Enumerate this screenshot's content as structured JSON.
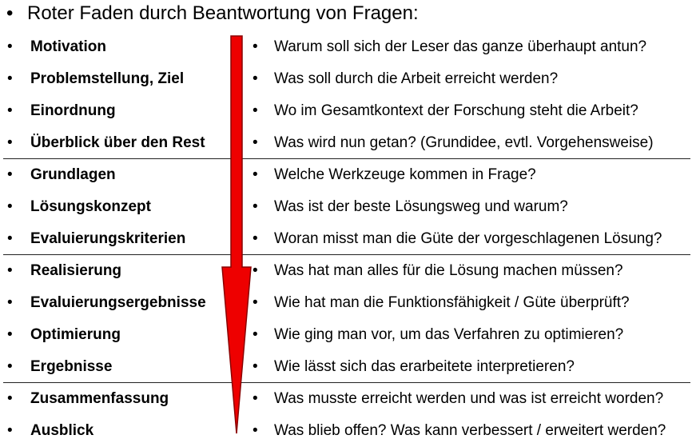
{
  "title": {
    "bullet": "•",
    "text": "Roter Faden durch Beantwortung von Fragen:"
  },
  "bullet": "•",
  "rows": [
    {
      "topic": "Motivation",
      "question": "Warum soll sich der Leser das ganze überhaupt antun?"
    },
    {
      "topic": "Problemstellung, Ziel",
      "question": "Was soll durch die Arbeit erreicht werden?"
    },
    {
      "topic": "Einordnung",
      "question": "Wo im Gesamtkontext der Forschung steht die Arbeit?"
    },
    {
      "topic": "Überblick über den Rest",
      "question": "Was wird nun getan? (Grundidee, evtl. Vorgehensweise)"
    },
    {
      "topic": "Grundlagen",
      "question": "Welche Werkzeuge kommen in Frage?"
    },
    {
      "topic": "Lösungskonzept",
      "question": "Was ist der beste Lösungsweg und warum?"
    },
    {
      "topic": "Evaluierungskriterien",
      "question": "Woran misst man die Güte der vorgeschlagenen Lösung?"
    },
    {
      "topic": "Realisierung",
      "question": "Was hat man alles für die Lösung machen müssen?"
    },
    {
      "topic": "Evaluierungsergebnisse",
      "question": "Wie hat man die Funktionsfähigkeit / Güte überprüft?"
    },
    {
      "topic": "Optimierung",
      "question": "Wie ging man vor, um das Verfahren zu optimieren?"
    },
    {
      "topic": "Ergebnisse",
      "question": "Wie lässt sich das erarbeitete interpretieren?"
    },
    {
      "topic": "Zusammenfassung",
      "question": "Was musste erreicht werden und was ist erreicht worden?"
    },
    {
      "topic": "Ausblick",
      "question": "Was blieb offen? Was kann verbessert / erweitert werden?"
    }
  ],
  "colors": {
    "arrow_fill": "#ee0000",
    "arrow_stroke": "#8a0000",
    "divider": "#222222"
  },
  "icons": {
    "arrow": "red-down-arrow-icon"
  }
}
